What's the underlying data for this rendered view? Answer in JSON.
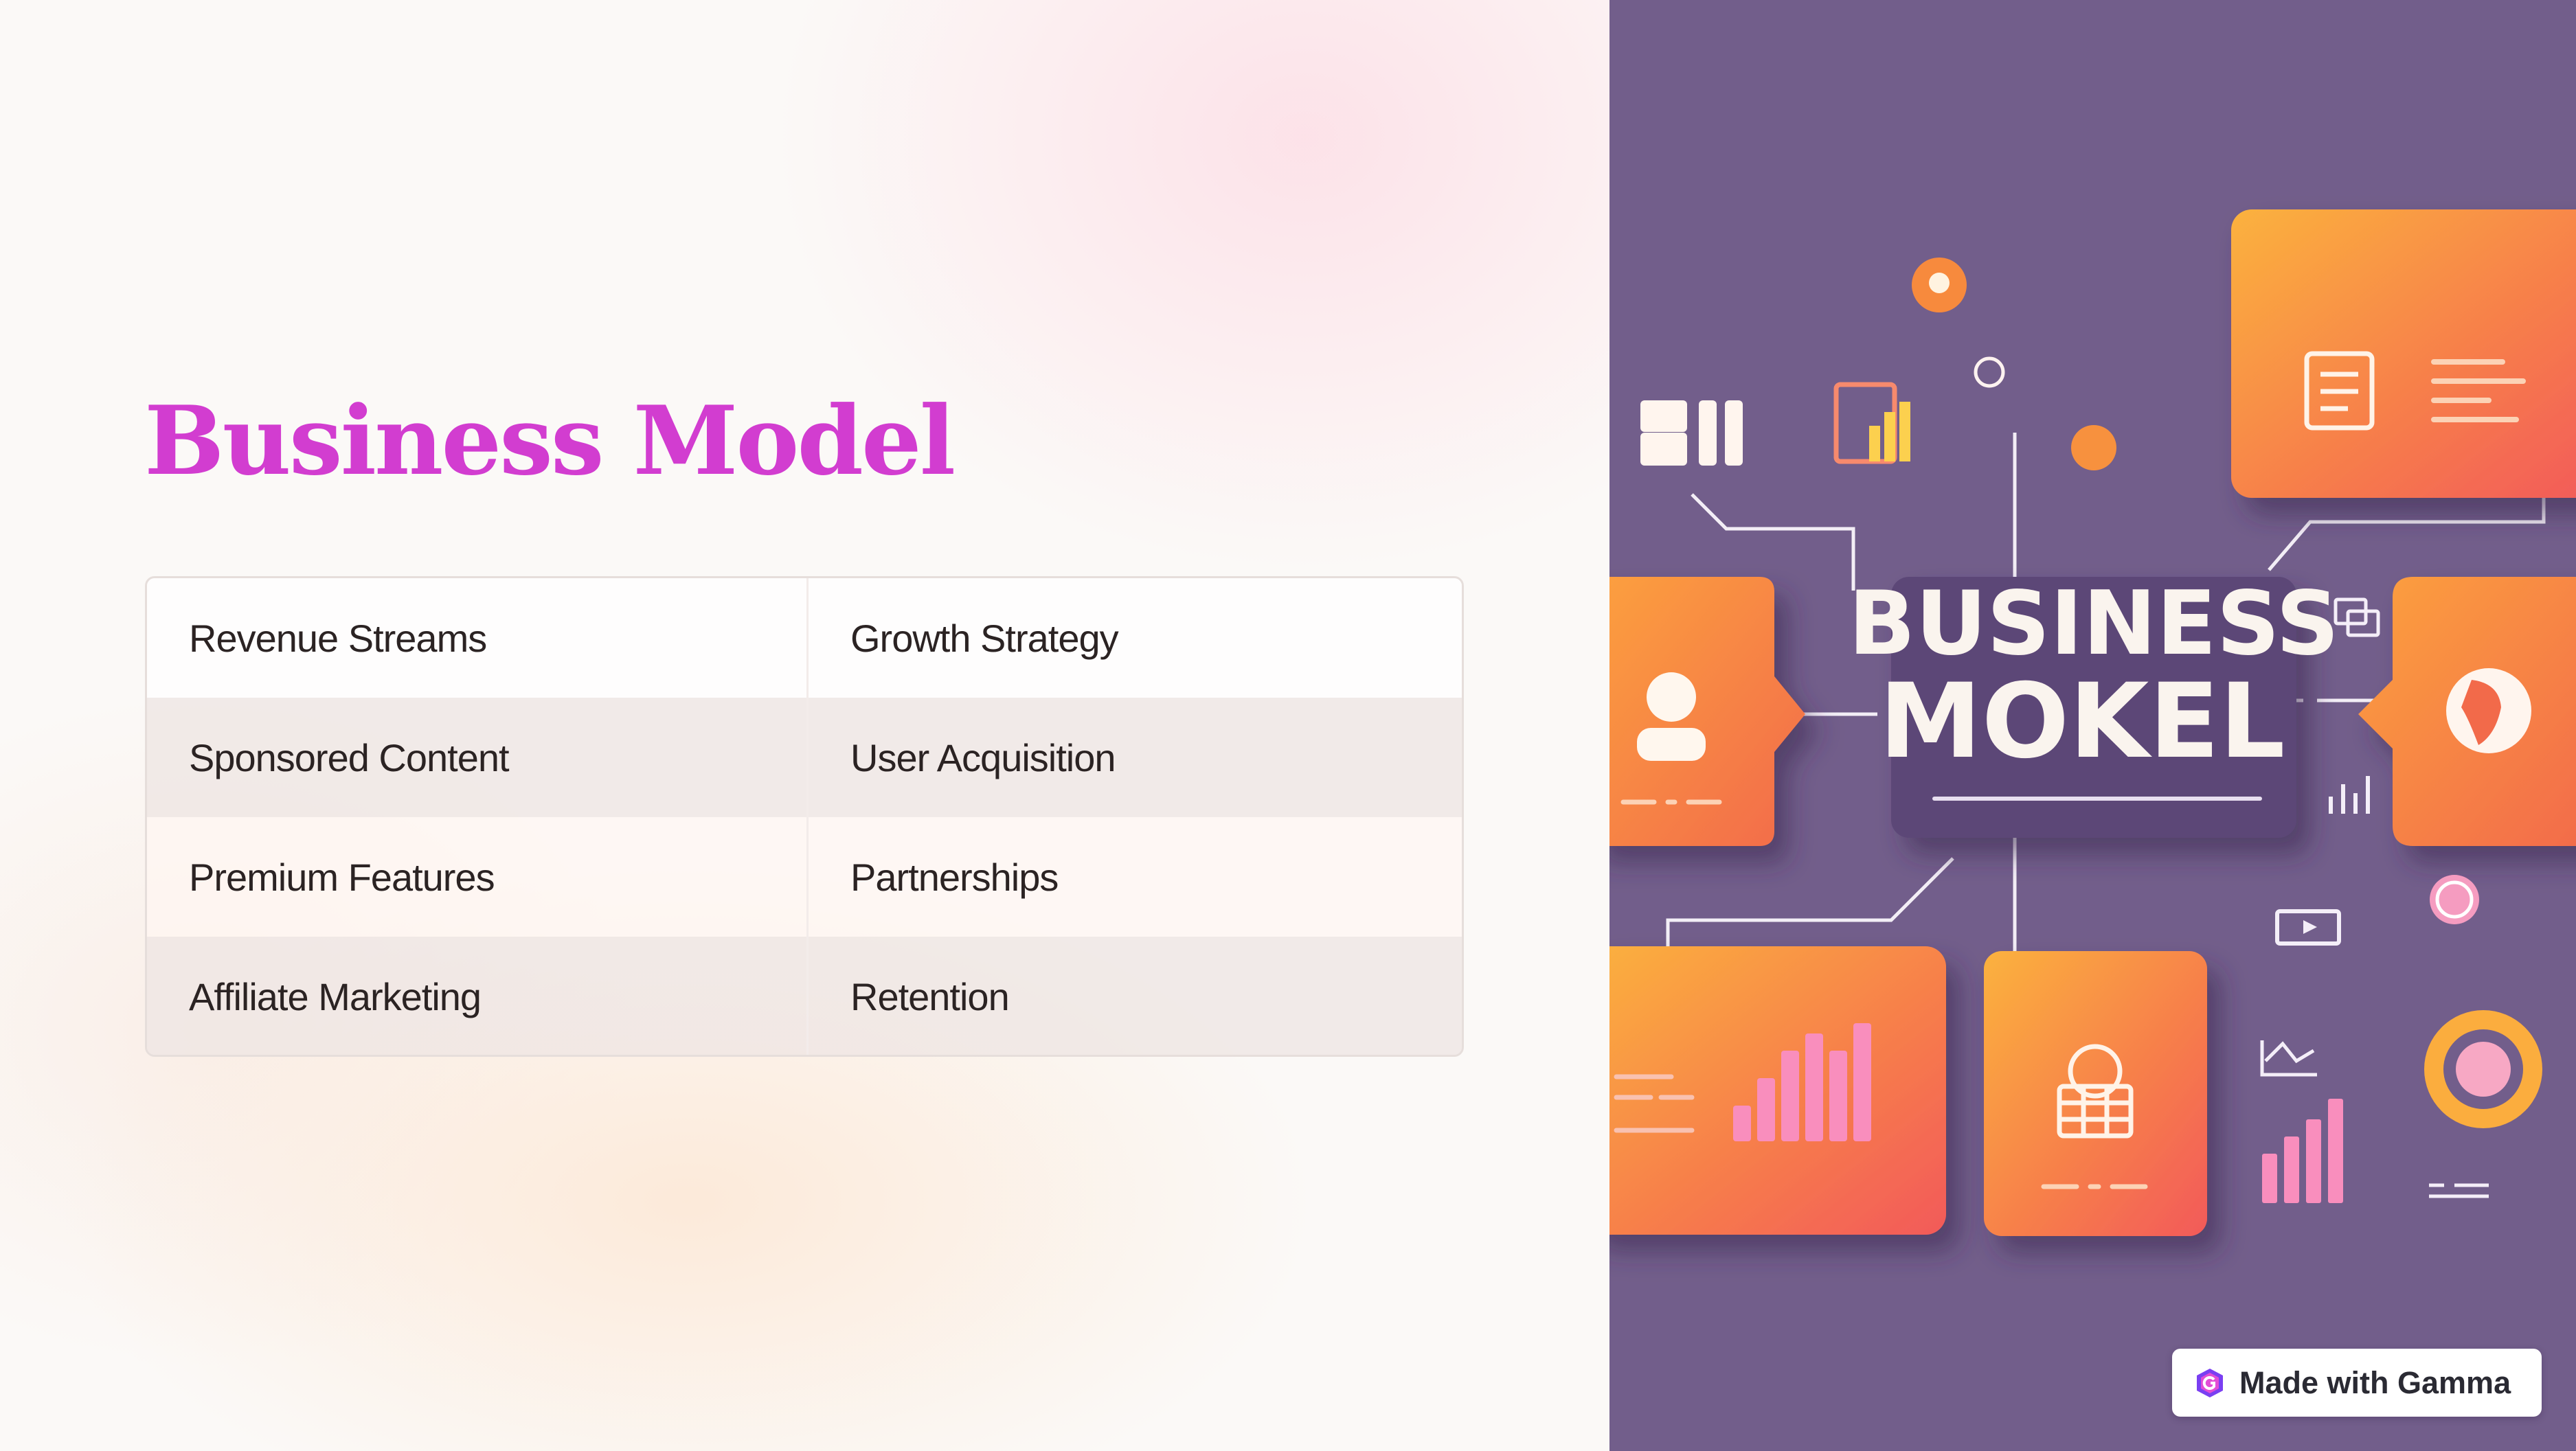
{
  "slide": {
    "title": "Business Model",
    "table": {
      "header": [
        "Revenue Streams",
        "Growth Strategy"
      ],
      "rows": [
        [
          "Sponsored Content",
          "User Acquisition"
        ],
        [
          "Premium Features",
          "Partnerships"
        ],
        [
          "Affiliate Marketing",
          "Retention"
        ]
      ]
    }
  },
  "illustration": {
    "headline_line1": "BUSINESS",
    "headline_line2": "MOKEL",
    "background_color": "#725e8b",
    "card_gradient": [
      "#fbb23e",
      "#f4584e"
    ]
  },
  "badge": {
    "label": "Made with Gamma",
    "icon": "gamma-logo-icon"
  },
  "colors": {
    "title": "#d23dd0",
    "text": "#2b2323"
  }
}
